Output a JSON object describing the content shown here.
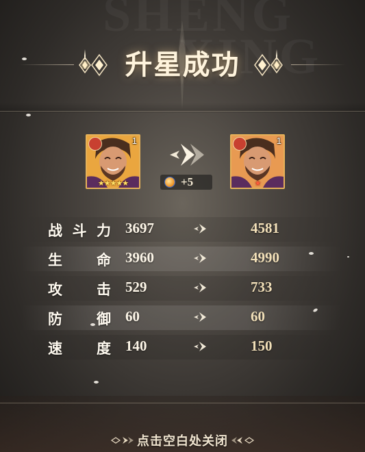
{
  "header": {
    "title": "升星成功",
    "watermark_line1": "SHENG",
    "watermark_line2": "XING"
  },
  "upgrade": {
    "before": {
      "level": "1",
      "stars": "★★★★★",
      "element_icon": "fire-icon"
    },
    "after": {
      "level": "1",
      "stars": "★",
      "element_icon": "fire-icon"
    },
    "cost_icon": "star-gem-icon",
    "cost_amount": "+5"
  },
  "stats": [
    {
      "label": "战斗力",
      "old": "3697",
      "new": "4581"
    },
    {
      "label": "生命",
      "old": "3960",
      "new": "4990"
    },
    {
      "label": "攻击",
      "old": "529",
      "new": "733"
    },
    {
      "label": "防御",
      "old": "60",
      "new": "60"
    },
    {
      "label": "速度",
      "old": "140",
      "new": "150"
    }
  ],
  "footer": {
    "close_hint": "点击空白处关闭"
  },
  "colors": {
    "accent_gold": "#e6b25a",
    "title_glow": "#ffd696",
    "text_main": "#fffaf0"
  }
}
